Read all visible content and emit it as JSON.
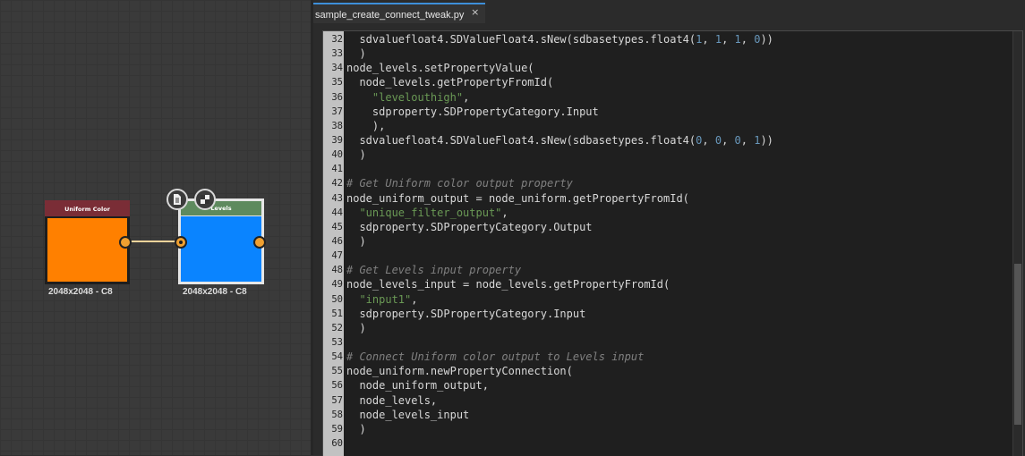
{
  "graph": {
    "nodes": [
      {
        "title": "Uniform Color",
        "size_label": "2048x2048 - C8",
        "title_color": "#7a2d36",
        "body_color": "#ff8000"
      },
      {
        "title": "Levels",
        "size_label": "2048x2048 - C8",
        "title_color": "#5e8a5e",
        "body_color": "#0a84ff"
      }
    ],
    "toolbar_icons": [
      "document-icon",
      "checker-icon"
    ]
  },
  "editor": {
    "tab": {
      "label": "sample_create_connect_tweak.py",
      "close": "×"
    },
    "lines": [
      {
        "n": "32",
        "code": "  sdvaluefloat4.SDValueFloat4.sNew(sdbasetypes.float4(1, 1, 1, 0))"
      },
      {
        "n": "33",
        "code": "  )"
      },
      {
        "n": "34",
        "code": "node_levels.setPropertyValue("
      },
      {
        "n": "35",
        "code": "  node_levels.getPropertyFromId("
      },
      {
        "n": "36",
        "code": "    \"levelouthigh\","
      },
      {
        "n": "37",
        "code": "    sdproperty.SDPropertyCategory.Input"
      },
      {
        "n": "38",
        "code": "    ),"
      },
      {
        "n": "39",
        "code": "  sdvaluefloat4.SDValueFloat4.sNew(sdbasetypes.float4(0, 0, 0, 1))"
      },
      {
        "n": "40",
        "code": "  )"
      },
      {
        "n": "41",
        "code": ""
      },
      {
        "n": "42",
        "code": "# Get Uniform color output property"
      },
      {
        "n": "43",
        "code": "node_uniform_output = node_uniform.getPropertyFromId("
      },
      {
        "n": "44",
        "code": "  \"unique_filter_output\","
      },
      {
        "n": "45",
        "code": "  sdproperty.SDPropertyCategory.Output"
      },
      {
        "n": "46",
        "code": "  )"
      },
      {
        "n": "47",
        "code": ""
      },
      {
        "n": "48",
        "code": "# Get Levels input property"
      },
      {
        "n": "49",
        "code": "node_levels_input = node_levels.getPropertyFromId("
      },
      {
        "n": "50",
        "code": "  \"input1\","
      },
      {
        "n": "51",
        "code": "  sdproperty.SDPropertyCategory.Input"
      },
      {
        "n": "52",
        "code": "  )"
      },
      {
        "n": "53",
        "code": ""
      },
      {
        "n": "54",
        "code": "# Connect Uniform color output to Levels input"
      },
      {
        "n": "55",
        "code": "node_uniform.newPropertyConnection("
      },
      {
        "n": "56",
        "code": "  node_uniform_output,"
      },
      {
        "n": "57",
        "code": "  node_levels,"
      },
      {
        "n": "58",
        "code": "  node_levels_input"
      },
      {
        "n": "59",
        "code": "  )"
      },
      {
        "n": "60",
        "code": ""
      }
    ],
    "current_line": "60"
  }
}
